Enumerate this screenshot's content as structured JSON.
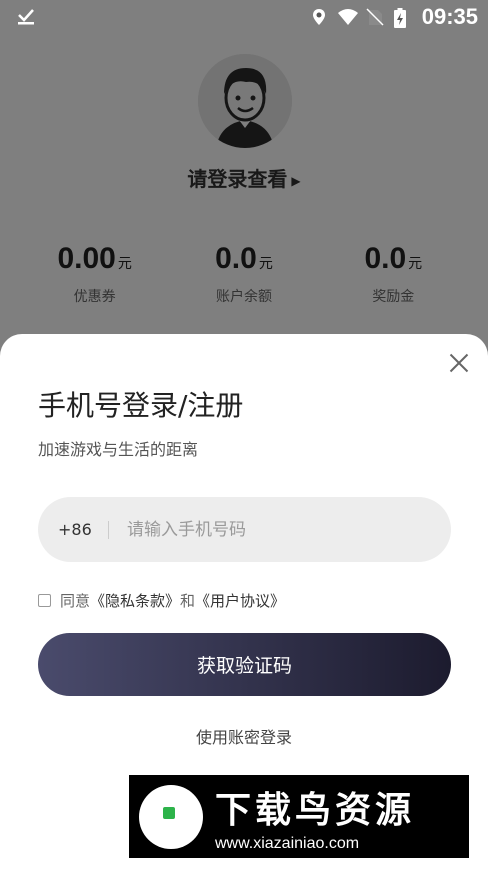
{
  "statusbar": {
    "time": "09:35"
  },
  "profile": {
    "login_prompt": "请登录查看"
  },
  "stats": [
    {
      "value": "0.00",
      "unit": "元",
      "label": "优惠券"
    },
    {
      "value": "0.0",
      "unit": "元",
      "label": "账户余额"
    },
    {
      "value": "0.0",
      "unit": "元",
      "label": "奖励金"
    }
  ],
  "sheet": {
    "title": "手机号登录/注册",
    "subtitle": "加速游戏与生活的距离",
    "phone": {
      "country_code": "+86",
      "placeholder": "请输入手机号码",
      "value": ""
    },
    "agreement": {
      "prefix": "同意",
      "privacy": "《隐私条款》",
      "and": "和",
      "user": "《用户协议》"
    },
    "get_code_label": "获取验证码",
    "password_login_label": "使用账密登录"
  },
  "watermark": {
    "title": "下载鸟资源",
    "url": "www.xiazainiao.com"
  }
}
